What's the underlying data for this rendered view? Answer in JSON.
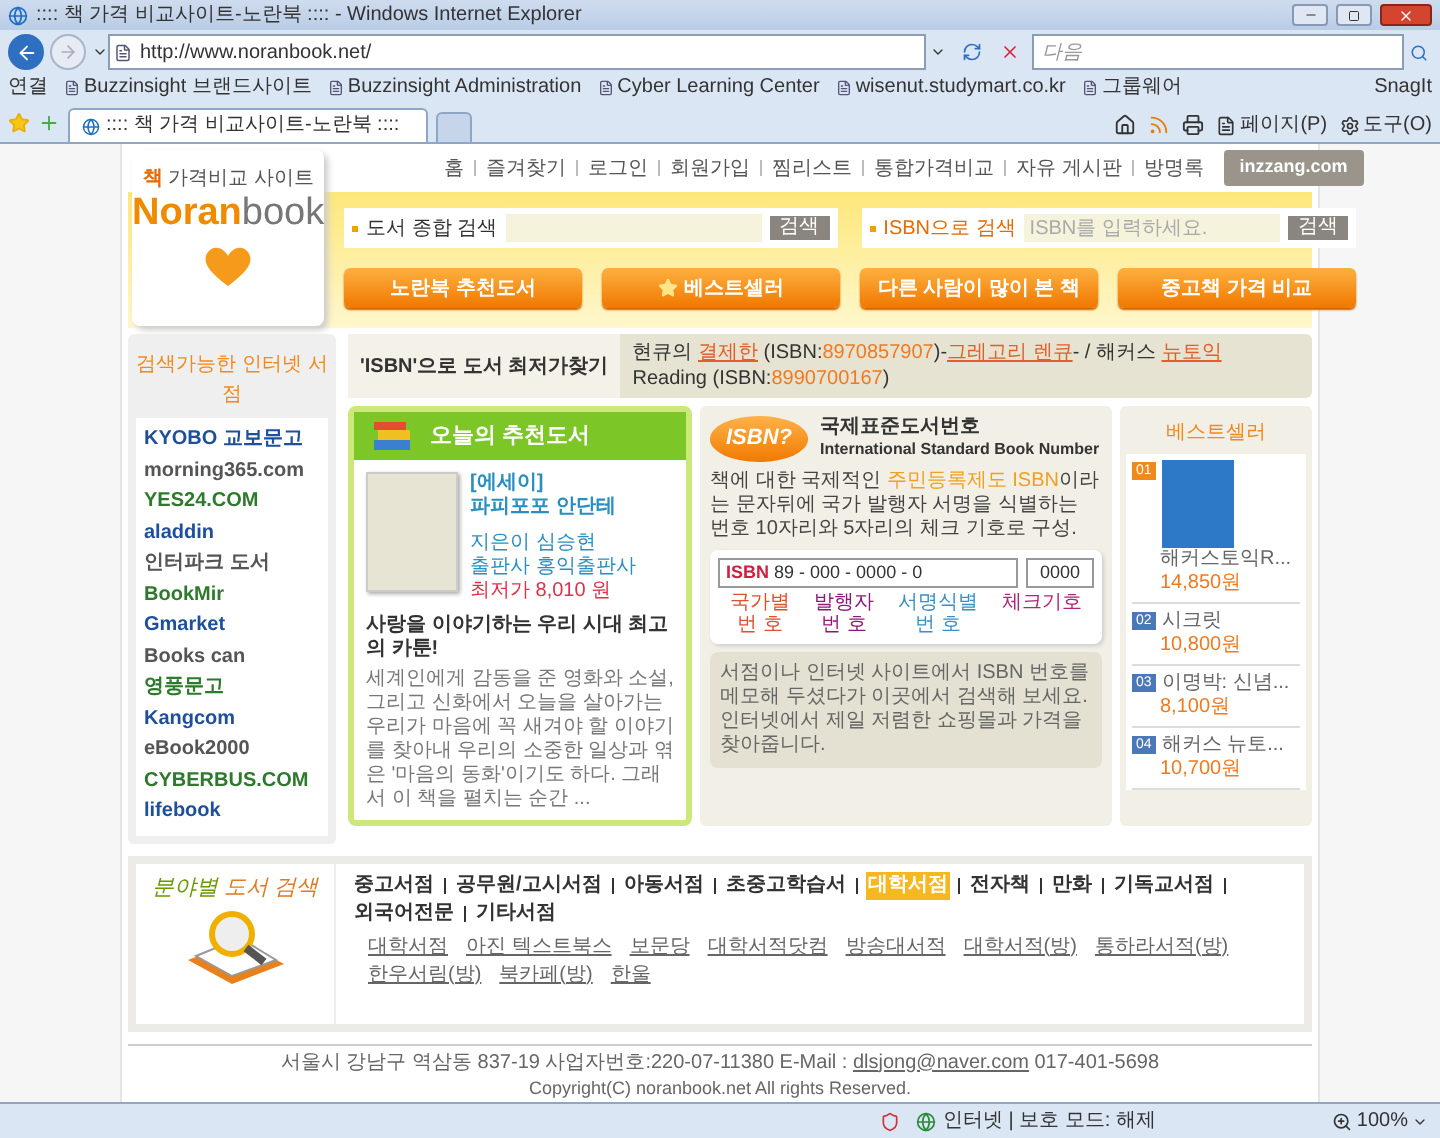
{
  "window": {
    "title": ":::: 책 가격 비교사이트-노란북 :::: - Windows Internet Explorer"
  },
  "address_bar": {
    "url": "http://www.noranbook.net/"
  },
  "search_box": {
    "placeholder": "다음"
  },
  "links_bar": {
    "label": "연결",
    "links": [
      "Buzzinsight 브랜드사이트",
      "Buzzinsight Administration",
      "Cyber Learning Center",
      "wisenut.studymart.co.kr",
      "그룹웨어"
    ],
    "snagit": "SnagIt"
  },
  "tabs": [
    {
      "label": ":::: 책 가격 비교사이트-노란북 ::::",
      "selected": true
    }
  ],
  "command_bar": {
    "page": "페이지(P)",
    "tools": "도구(O)"
  },
  "site": {
    "logo": {
      "tagline_mark": "책",
      "tagline": "가격비교 사이트",
      "name_1": "Noran",
      "name_2": "book"
    },
    "top_nav": [
      "홈",
      "즐겨찾기",
      "로그인",
      "회원가입",
      "찜리스트",
      "통합가격비교",
      "자유 게시판",
      "방명록"
    ],
    "badge": "inzzang.com",
    "search": [
      {
        "label": "도서 종합 검색",
        "button": "검색"
      },
      {
        "label": "ISBN으로 검색",
        "placeholder": "ISBN를 입력하세요.",
        "button": "검색"
      }
    ],
    "menu_buttons": [
      {
        "label": "노란북 추천도서",
        "kind": "plain"
      },
      {
        "label": "베스트셀러",
        "kind": "star"
      },
      {
        "label": "다른 사람이 많이 본 책",
        "kind": "plain"
      },
      {
        "label": "중고책 가격 비교",
        "kind": "plain"
      }
    ],
    "bookstores": {
      "title": "검색가능한 인터넷 서점",
      "items": [
        "KYOBO 교보문고",
        "morning365.com",
        "YES24.COM",
        "aladdin",
        "인터파크 도서",
        "BookMir",
        "Gmarket",
        "Books can",
        "영풍문고",
        "Kangcom",
        "eBook2000",
        "CYBERBUS.COM",
        "lifebook"
      ]
    },
    "isbn_strip": {
      "label": "'ISBN'으로 도서 최저가찾기",
      "segments": [
        {
          "text": "현큐의 ",
          "kind": "text"
        },
        {
          "text": "결제한",
          "kind": "link"
        },
        {
          "text": " (ISBN:",
          "kind": "text"
        },
        {
          "text": "8970857907",
          "kind": "number"
        },
        {
          "text": ")-",
          "kind": "text"
        },
        {
          "text": "그레고리 렌큐",
          "kind": "link"
        },
        {
          "text": "- / 해커스 ",
          "kind": "text"
        },
        {
          "text": "뉴토익",
          "kind": "link"
        },
        {
          "text": " Reading (ISBN:",
          "kind": "text"
        },
        {
          "text": "8990700167",
          "kind": "number"
        },
        {
          "text": ")",
          "kind": "text"
        }
      ]
    },
    "recommended": {
      "title": "오늘의 추천도서",
      "genre": "[에세이]",
      "book_title": "파피포포 안단테",
      "author": "지은이 심승현",
      "publisher": "출판사 홍익출판사",
      "price": "최저가 8,010 원",
      "headline": "사랑을 이야기하는 우리 시대 최고의 카툰!",
      "description": "세계인에게 감동을 준 영화와 소설, 그리고 신화에서 오늘을 살아가는 우리가 마음에 꼭 새겨야 할 이야기를 찾아내 우리의 소중한 일상과 엮은 '마음의 동화'이기도 하다. 그래서 이 책을 펼치는 순간 ..."
    },
    "isbn_info": {
      "badge": "ISBN?",
      "title": "국제표준도서번호",
      "subtitle": "International Standard Book Number",
      "description": [
        {
          "text": "책에 대한 국제적인 ",
          "kind": "text"
        },
        {
          "text": "주민등록제도 ISBN",
          "kind": "highlight"
        },
        {
          "text": "이라는 문자뒤에 국가 발행자 서명을 식별하는 번호 10자리와 5자리의 체크 기호로 구성.",
          "kind": "text"
        }
      ],
      "diagram": {
        "prefix": "ISBN",
        "digits": "89 - 000 - 0000 - 0",
        "check": "0000",
        "labels": [
          {
            "lines": [
              "국가별",
              "번 호"
            ],
            "color": "#e0502a"
          },
          {
            "lines": [
              "발행자",
              "번 호"
            ],
            "color": "#8b1a7a"
          },
          {
            "lines": [
              "서명식별",
              "번 호"
            ],
            "color": "#3a8fc8"
          },
          {
            "lines": [
              "체크기호"
            ],
            "color": "#b0247a"
          }
        ]
      },
      "note": "서점이나 인터넷 사이트에서 ISBN 번호를 메모해 두셨다가 이곳에서 검색해 보세요. 인터넷에서 제일 저렴한 쇼핑몰과 가격을 찾아줍니다."
    },
    "bestsellers": {
      "title": "베스트셀러",
      "items": [
        {
          "rank": "01",
          "title": "해커스토익R...",
          "price": "14,850원",
          "color": "#f08a1c",
          "kind": "cover"
        },
        {
          "rank": "02",
          "title": "시크릿",
          "price": "10,800원",
          "color": "#4a78b8",
          "kind": "plain"
        },
        {
          "rank": "03",
          "title": "이명박: 신념...",
          "price": "8,100원",
          "color": "#4a78b8",
          "kind": "plain"
        },
        {
          "rank": "04",
          "title": "해커스 뉴토...",
          "price": "10,700원",
          "color": "#4a78b8",
          "kind": "plain"
        }
      ]
    },
    "categories": {
      "title_1": "분야별",
      "title_2": "도서 검색",
      "items": [
        {
          "label": "중고서점",
          "selected": false
        },
        {
          "label": "공무원/고시서점",
          "selected": false
        },
        {
          "label": "아동서점",
          "selected": false
        },
        {
          "label": "초중고학습서",
          "selected": false
        },
        {
          "label": "대학서점",
          "selected": true
        },
        {
          "label": "전자책",
          "selected": false
        },
        {
          "label": "만화",
          "selected": false
        },
        {
          "label": "기독교서점",
          "selected": false
        },
        {
          "label": "외국어전문",
          "selected": false
        },
        {
          "label": "기타서점",
          "selected": false
        }
      ],
      "sub_items": [
        "대학서점",
        "아진 텍스트북스",
        "보문당",
        "대학서적닷컴",
        "방송대서적",
        "대학서적(방)",
        "통하라서적(방)",
        "한우서림(방)",
        "북카페(방)",
        "한울"
      ]
    },
    "footer": {
      "address": "서울시 강남구 역삼동 837-19 사업자번호:220-07-11380 E-Mail :",
      "email": "dlsjong@naver.com",
      "phone": "017-401-5698",
      "copyright": "Copyright(C) noranbook.net All rights Reserved."
    }
  },
  "status_bar": {
    "zone": "인터넷 | 보호 모드: 해제",
    "zoom": "100%"
  }
}
